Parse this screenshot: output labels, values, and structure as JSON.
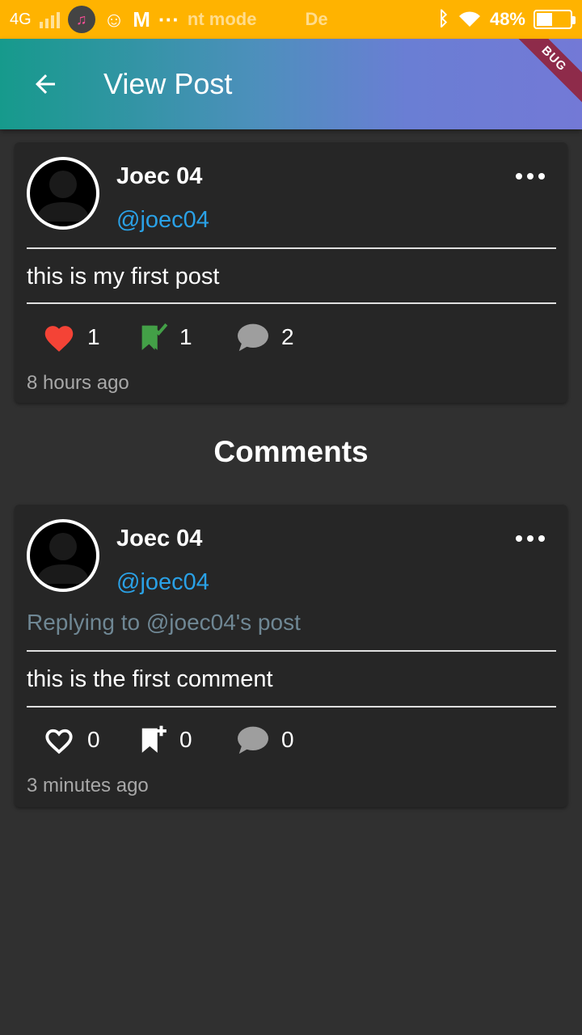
{
  "status_bar": {
    "network": "4G",
    "notification_text": "nt mode",
    "notification_text_2": "De",
    "battery": "48%",
    "battery_level": 0.48
  },
  "app_bar": {
    "title": "View Post",
    "debug_banner": "BUG"
  },
  "post": {
    "author_name": "Joec 04",
    "author_handle": "@joec04",
    "text": "this is my first post",
    "likes": "1",
    "bookmarks": "1",
    "comments": "2",
    "time": "8 hours ago",
    "liked": true,
    "bookmarked": true
  },
  "comments_heading": "Comments",
  "comments": [
    {
      "author_name": "Joec 04",
      "author_handle": "@joec04",
      "replying_to": "Replying to @joec04's post",
      "text": "this is the first comment",
      "likes": "0",
      "bookmarks": "0",
      "comments": "0",
      "time": "3 minutes ago"
    }
  ],
  "colors": {
    "status_bar": "#ffb300",
    "handle": "#2aa1e6",
    "like_active": "#f44336",
    "bookmark_active": "#43a047",
    "reply_to": "#6f8794",
    "card": "#262626",
    "background": "#303030"
  }
}
